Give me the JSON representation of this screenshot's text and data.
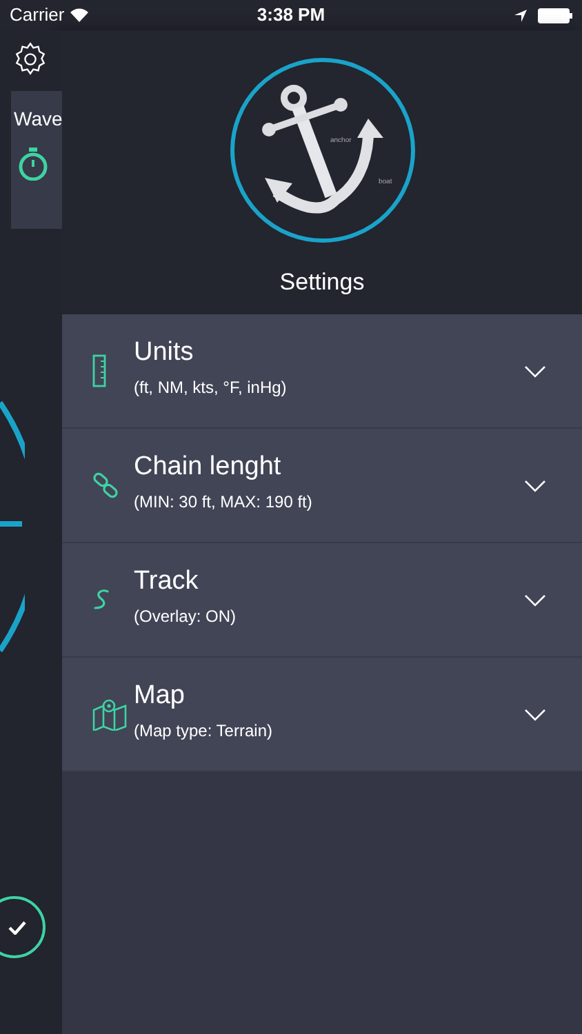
{
  "status_bar": {
    "carrier": "Carrier",
    "time": "3:38 PM"
  },
  "background_screen": {
    "card_title": "Wave"
  },
  "header": {
    "logo_labels": [
      "anchor",
      "boat"
    ],
    "title": "Settings"
  },
  "settings": [
    {
      "kind": "ruler",
      "title": "Units",
      "subtitle": "(ft, NM, kts, °F, inHg)",
      "expanded": false
    },
    {
      "kind": "chain",
      "title": "Chain lenght",
      "subtitle": "(MIN: 30 ft, MAX: 190 ft)",
      "expanded": false
    },
    {
      "kind": "track",
      "title": "Track",
      "subtitle": "(Overlay: ON)",
      "expanded": false
    },
    {
      "kind": "map",
      "title": "Map",
      "subtitle": "(Map type: Terrain)",
      "expanded": false
    }
  ]
}
